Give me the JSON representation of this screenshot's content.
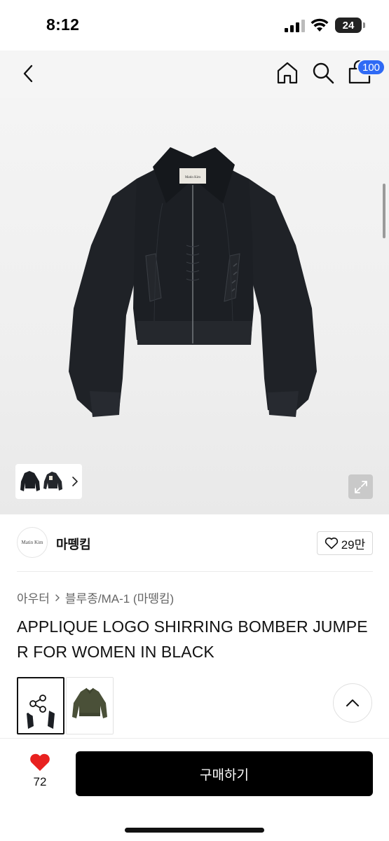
{
  "status_bar": {
    "time": "8:12",
    "battery": "24",
    "icons": [
      "signal-icon",
      "wifi-icon",
      "battery-icon"
    ]
  },
  "nav": {
    "icons": [
      "back-chevron-icon",
      "home-icon",
      "search-icon",
      "shopping-bag-icon"
    ],
    "cart_badge": "100",
    "badge_color": "#2f6af5"
  },
  "gallery": {
    "thumbnail_icons": [
      "jacket-front-thumb",
      "jacket-back-thumb"
    ],
    "expand_icon": "expand-arrows-icon"
  },
  "brand": {
    "logo_text": "Matin  Kim",
    "name": "마뗑킴",
    "likes": "29만"
  },
  "breadcrumb": {
    "category": "아우터",
    "subcategory": "블루종/MA-1 (마뗑킴)"
  },
  "product": {
    "title": "APPLIQUE LOGO SHIRRING BOMBER JUMPER FOR WOMEN IN BLACK"
  },
  "color_options": {
    "selected": "black",
    "options": [
      "black",
      "khaki"
    ]
  },
  "bottom_bar": {
    "like_count": "72",
    "heart_color": "#e8211f",
    "buy_label": "구매하기"
  }
}
